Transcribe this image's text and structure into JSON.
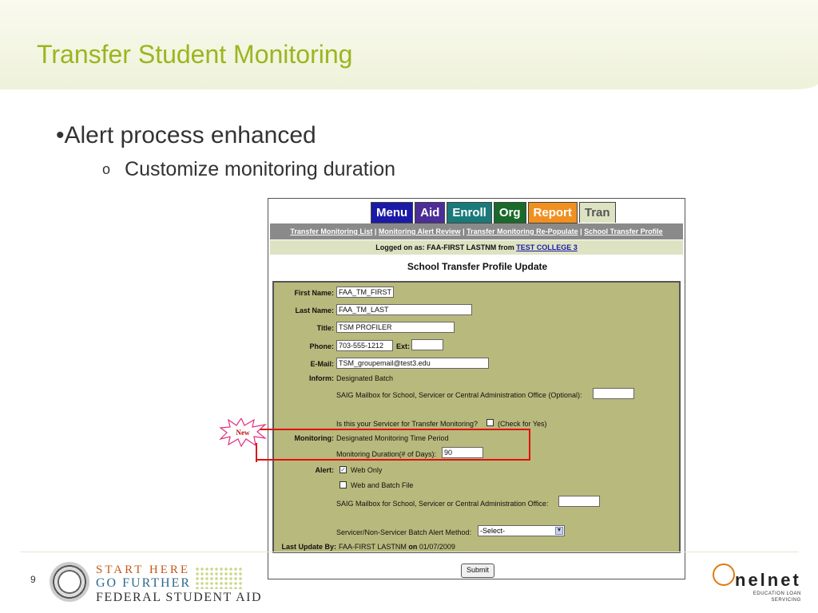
{
  "slide": {
    "title": "Transfer Student Monitoring",
    "bullet1": "•Alert process enhanced",
    "bullet2_marker": "o",
    "bullet2": "Customize monitoring duration",
    "page_number": "9"
  },
  "footer": {
    "fsa_line1": "START HERE",
    "fsa_line2": "GO FURTHER",
    "fsa_line3": "FEDERAL STUDENT AID",
    "nelnet_logo": "nelnet",
    "nelnet_sub1": "EDUCATION LOAN",
    "nelnet_sub2": "SERVICING"
  },
  "screenshot": {
    "tabs": [
      "Menu",
      "Aid",
      "Enroll",
      "Org",
      "Report",
      "Tran"
    ],
    "nav_links": [
      "Transfer Monitoring List",
      "Monitoring Alert Review",
      "Transfer Monitoring Re-Populate",
      "School Transfer Profile"
    ],
    "logged_prefix": "Logged on as: FAA-FIRST LASTNM from",
    "college": "TEST COLLEGE 3",
    "form_title": "School Transfer Profile Update",
    "labels": {
      "first_name": "First Name:",
      "last_name": "Last Name:",
      "title": "Title:",
      "phone": "Phone:",
      "ext": "Ext:",
      "email": "E-Mail:",
      "inform": "Inform:",
      "monitoring": "Monitoring:",
      "alert": "Alert:",
      "last_update": "Last Update By:"
    },
    "values": {
      "first_name": "FAA_TM_FIRST",
      "last_name": "FAA_TM_LAST",
      "title": "TSM PROFILER",
      "phone": "703-555-1212",
      "ext": "",
      "email": "TSM_groupemail@test3.edu",
      "monitoring_duration": "90",
      "saig_inform": "",
      "saig_alert": ""
    },
    "texts": {
      "inform_value": "Designated Batch",
      "saig_optional": "SAIG Mailbox for School, Servicer or Central Administration Office (Optional):",
      "servicer_question": "Is this your Servicer for Transfer Monitoring?",
      "check_for_yes": "(Check for Yes)",
      "monitoring_value": "Designated Monitoring Time Period",
      "duration_label": "Monitoring Duration(# of Days):",
      "web_only": "Web Only",
      "web_batch": "Web and Batch File",
      "saig_required": "SAIG Mailbox for School, Servicer or Central Administration Office:",
      "alert_method": "Servicer/Non-Servicer Batch Alert Method:",
      "last_update_value": "FAA-FIRST LASTNM",
      "on_word": "on",
      "last_update_date": "01/07/2009"
    },
    "select_value": "-Select-",
    "submit_label": "Submit",
    "new_badge": "New"
  },
  "colors": {
    "title_green": "#9cb51e",
    "panel_bg": "#b8b97c",
    "highlight_red": "#e01010"
  }
}
